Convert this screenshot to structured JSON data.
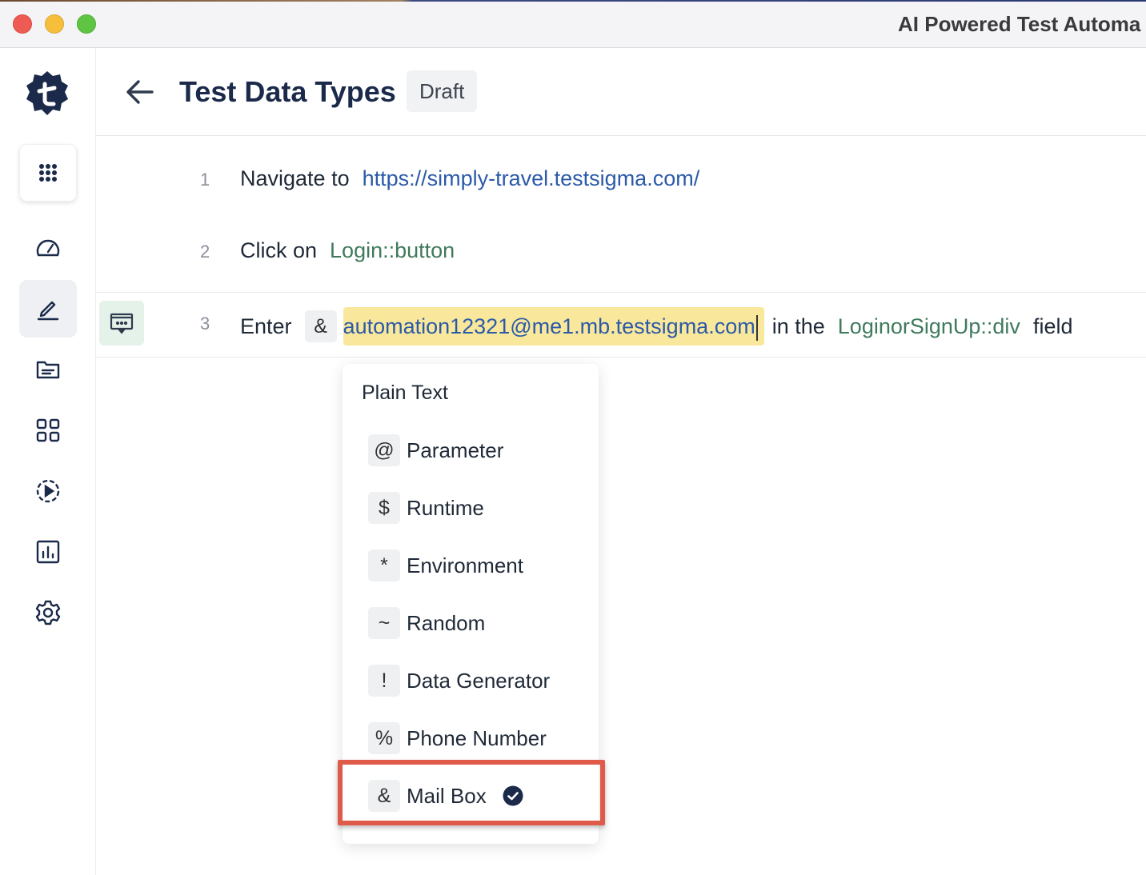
{
  "window": {
    "title": "AI Powered Test Automa"
  },
  "header": {
    "title": "Test Data Types",
    "status": "Draft"
  },
  "steps": [
    {
      "number": "1",
      "action": "Navigate to",
      "target": "https://simply-travel.testsigma.com/"
    },
    {
      "number": "2",
      "action": "Click on",
      "target": "Login::button"
    },
    {
      "number": "3",
      "action": "Enter",
      "data_type_symbol": "&",
      "value": "automation12321@me1.mb.testsigma.com",
      "connector": "in the",
      "element": "LoginorSignUp::div",
      "suffix": "field"
    }
  ],
  "dropdown": {
    "header": "Plain Text",
    "items": [
      {
        "symbol": "@",
        "label": "Parameter"
      },
      {
        "symbol": "$",
        "label": "Runtime"
      },
      {
        "symbol": "*",
        "label": "Environment"
      },
      {
        "symbol": "~",
        "label": "Random"
      },
      {
        "symbol": "!",
        "label": "Data Generator"
      },
      {
        "symbol": "%",
        "label": "Phone Number"
      },
      {
        "symbol": "&",
        "label": "Mail Box",
        "selected": true
      }
    ]
  },
  "icons": {
    "logo": "testsigma-logo",
    "nav": [
      "apps-grid-icon",
      "dashboard-gauge-icon",
      "edit-pen-icon",
      "folder-icon",
      "modules-grid-icon",
      "run-play-icon",
      "reports-chart-icon",
      "settings-gear-icon"
    ],
    "back": "arrow-left-icon",
    "step_action": "step-options-icon",
    "check": "check-circle-icon"
  },
  "colors": {
    "accent": "#1b2a4a",
    "link": "#2b5aa8",
    "element": "#3f7a5c",
    "highlight": "#f9e79b",
    "callout": "#e05a4a"
  }
}
